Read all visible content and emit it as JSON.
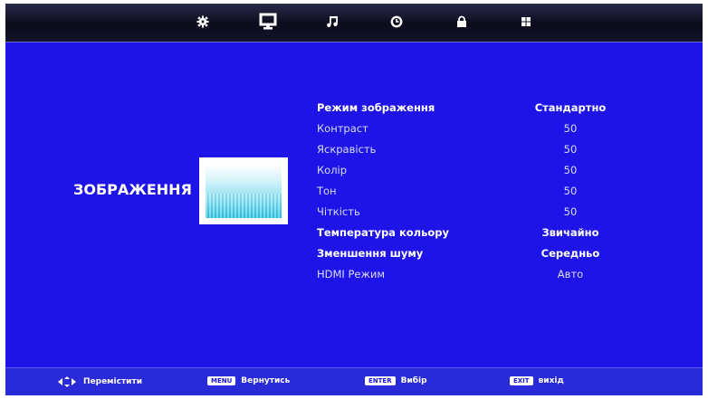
{
  "menu": {
    "tabs": [
      {
        "icon": "gear-icon",
        "active": false
      },
      {
        "icon": "monitor-icon",
        "active": true
      },
      {
        "icon": "music-note-icon",
        "active": false
      },
      {
        "icon": "clock-icon",
        "active": false
      },
      {
        "icon": "lock-icon",
        "active": false
      },
      {
        "icon": "grid-icon",
        "active": false
      }
    ]
  },
  "section": {
    "title": "ЗОБРАЖЕННЯ"
  },
  "settings": [
    {
      "label": "Режим зображення",
      "value": "Стандартно",
      "bold": true
    },
    {
      "label": "Контраст",
      "value": "50",
      "bold": false
    },
    {
      "label": "Яскравість",
      "value": "50",
      "bold": false
    },
    {
      "label": "Колір",
      "value": "50",
      "bold": false
    },
    {
      "label": "Тон",
      "value": "50",
      "bold": false
    },
    {
      "label": "Чіткість",
      "value": "50",
      "bold": false
    },
    {
      "label": "Температура кольору",
      "value": "Звичайно",
      "bold": true
    },
    {
      "label": "Зменшення шуму",
      "value": "Середньо",
      "bold": true
    },
    {
      "label": "HDMI Режим",
      "value": "Авто",
      "bold": false
    }
  ],
  "footer": {
    "move": {
      "icon": "dpad-arrows-icon",
      "label": "Перемістити"
    },
    "back": {
      "key": "MENU",
      "label": "Вернутись"
    },
    "select": {
      "key": "ENTER",
      "label": "Вибір"
    },
    "exit": {
      "key": "EXIT",
      "label": "вихід"
    }
  },
  "colors": {
    "background": "#1f14e8",
    "topbar": "#0b0b1c",
    "bottombar": "#2a2bd8"
  }
}
